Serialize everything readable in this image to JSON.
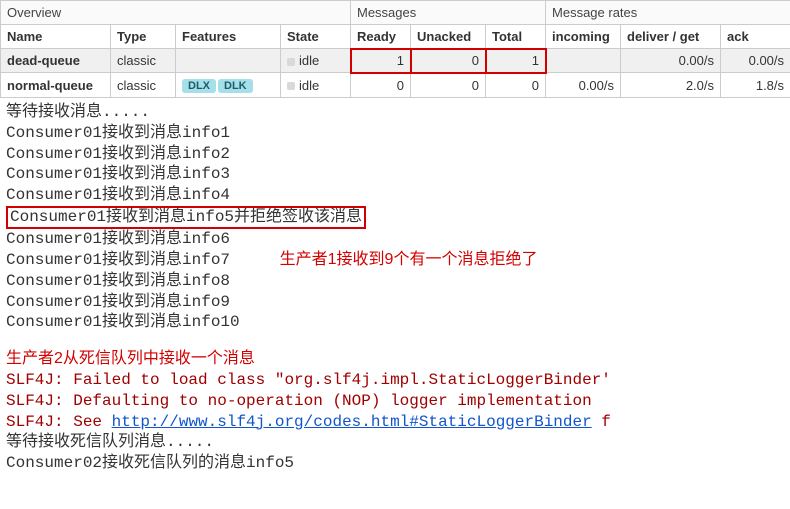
{
  "groups": {
    "overview": "Overview",
    "messages": "Messages",
    "rates": "Message rates"
  },
  "cols": {
    "name": "Name",
    "type": "Type",
    "features": "Features",
    "state": "State",
    "ready": "Ready",
    "unacked": "Unacked",
    "total": "Total",
    "incoming": "incoming",
    "deliver": "deliver / get",
    "ack": "ack"
  },
  "rows": [
    {
      "name": "dead-queue",
      "type": "classic",
      "features": [],
      "state": "idle",
      "ready": "1",
      "unacked": "0",
      "total": "1",
      "incoming": "",
      "deliver": "0.00/s",
      "ack": "0.00/s",
      "highlight": true
    },
    {
      "name": "normal-queue",
      "type": "classic",
      "features": [
        "DLX",
        "DLK"
      ],
      "state": "idle",
      "ready": "0",
      "unacked": "0",
      "total": "0",
      "incoming": "0.00/s",
      "deliver": "2.0/s",
      "ack": "1.8/s",
      "highlight": false
    }
  ],
  "consoleA": {
    "wait": "等待接收消息.....",
    "l1": "Consumer01接收到消息info1",
    "l2": "Consumer01接收到消息info2",
    "l3": "Consumer01接收到消息info3",
    "l4": "Consumer01接收到消息info4",
    "l5": "Consumer01接收到消息info5并拒绝签收该消息",
    "l6": "Consumer01接收到消息info6",
    "l7": "Consumer01接收到消息info7",
    "l8": "Consumer01接收到消息info8",
    "l9": "Consumer01接收到消息info9",
    "l10": "Consumer01接收到消息info10"
  },
  "annot1": "生产者1接收到9个有一个消息拒绝了",
  "annot2": "生产者2从死信队列中接收一个消息",
  "consoleB": {
    "s1a": "SLF4J: Failed to load class \"org.slf4j.impl.StaticLoggerBinder'",
    "s2a": "SLF4J: Defaulting to no-operation (NOP) logger implementation",
    "s3a": "SLF4J: See ",
    "s3link": "http://www.slf4j.org/codes.html#StaticLoggerBinder",
    "s3b": " f",
    "wait": "等待接收死信队列消息.....",
    "recv": "Consumer02接收死信队列的消息info5"
  }
}
